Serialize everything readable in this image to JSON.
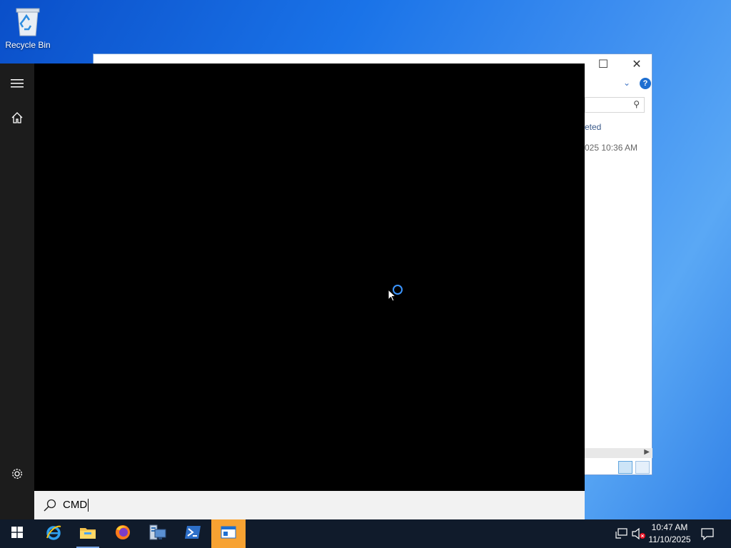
{
  "desktop": {
    "icons": [
      {
        "label": "Recycle Bin",
        "icon": "recycle-bin-icon"
      }
    ]
  },
  "explorer": {
    "column_header_partial": "eted",
    "row_date_partial": "025 10:36 AM",
    "controls": {
      "maximize": "☐",
      "close": "✕"
    },
    "help": "?"
  },
  "start_menu": {
    "rail": [
      {
        "name": "hamburger-menu-icon"
      },
      {
        "name": "home-icon"
      },
      {
        "name": "settings-icon"
      }
    ],
    "search": {
      "query": "CMD",
      "icon": "search-icon"
    },
    "loading": true
  },
  "taskbar": {
    "apps": [
      {
        "name": "start-button",
        "icon": "windows-logo-icon"
      },
      {
        "name": "internet-explorer-button",
        "icon": "internet-explorer-icon"
      },
      {
        "name": "file-explorer-button",
        "icon": "folder-icon",
        "running": true
      },
      {
        "name": "firefox-button",
        "icon": "firefox-icon"
      },
      {
        "name": "server-manager-button",
        "icon": "server-manager-icon"
      },
      {
        "name": "powershell-button",
        "icon": "powershell-icon"
      },
      {
        "name": "active-app-button",
        "icon": "app-window-icon",
        "active": true
      }
    ],
    "tray": {
      "network": "network-icon",
      "volume": "volume-muted-icon",
      "notifications": "notification-icon"
    },
    "clock": {
      "time": "10:47 AM",
      "date": "11/10/2025"
    }
  },
  "colors": {
    "start_menu_bg": "#000000",
    "rail_bg": "#1c1c1c",
    "search_bg": "#f2f2f2",
    "taskbar_bg": "#101b2b",
    "accent": "#3b95ff",
    "active_app": "#f7a232"
  }
}
